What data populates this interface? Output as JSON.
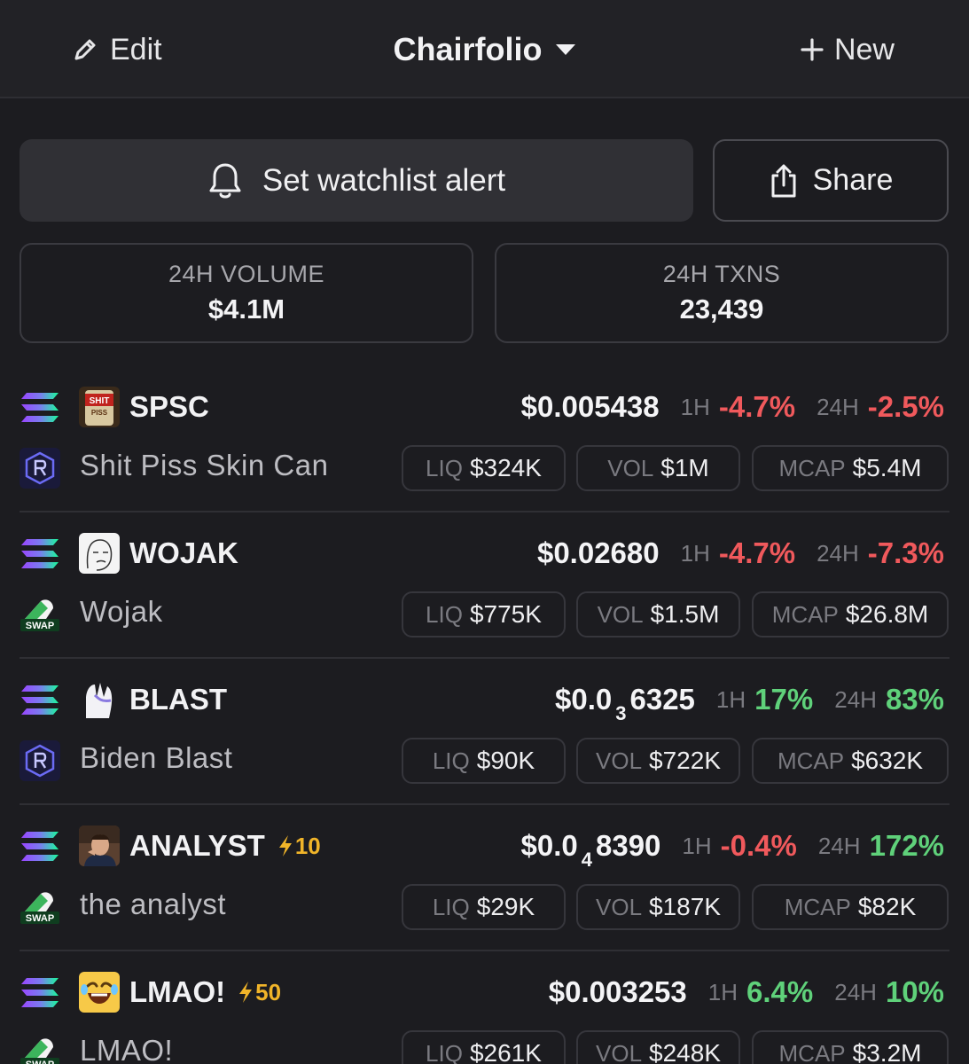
{
  "header": {
    "edit_label": "Edit",
    "title": "Chairfolio",
    "new_label": "New"
  },
  "actions": {
    "alert_label": "Set watchlist alert",
    "share_label": "Share"
  },
  "stats": {
    "volume_label": "24H VOLUME",
    "volume_value": "$4.1M",
    "txns_label": "24H TXNS",
    "txns_value": "23,439"
  },
  "labels": {
    "h1": "1H",
    "h24": "24H",
    "liq": "LIQ",
    "vol": "VOL",
    "mcap": "MCAP"
  },
  "tokens": [
    {
      "symbol": "SPSC",
      "name": "Shit Piss Skin Can",
      "price_pre": "$0.005438",
      "price_sub": "",
      "price_post": "",
      "h1": "-4.7%",
      "h24": "-2.5%",
      "liq": "$324K",
      "vol": "$1M",
      "mcap": "$5.4M",
      "boost": "",
      "dex": "raydium",
      "avatar_text": "SHIT PISS"
    },
    {
      "symbol": "WOJAK",
      "name": "Wojak",
      "price_pre": "$0.02680",
      "price_sub": "",
      "price_post": "",
      "h1": "-4.7%",
      "h24": "-7.3%",
      "liq": "$775K",
      "vol": "$1.5M",
      "mcap": "$26.8M",
      "boost": "",
      "dex": "swap"
    },
    {
      "symbol": "BLAST",
      "name": "Biden Blast",
      "price_pre": "$0.0",
      "price_sub": "3",
      "price_post": "6325",
      "h1": "17%",
      "h24": "83%",
      "liq": "$90K",
      "vol": "$722K",
      "mcap": "$632K",
      "boost": "",
      "dex": "raydium"
    },
    {
      "symbol": "ANALYST",
      "name": "the analyst",
      "price_pre": "$0.0",
      "price_sub": "4",
      "price_post": "8390",
      "h1": "-0.4%",
      "h24": "172%",
      "liq": "$29K",
      "vol": "$187K",
      "mcap": "$82K",
      "boost": "10",
      "dex": "swap"
    },
    {
      "symbol": "LMAO!",
      "name": "LMAO!",
      "price_pre": "$0.003253",
      "price_sub": "",
      "price_post": "",
      "h1": "6.4%",
      "h24": "10%",
      "liq": "$261K",
      "vol": "$248K",
      "mcap": "$3.2M",
      "boost": "50",
      "dex": "swap"
    }
  ],
  "colors": {
    "negative": "#f0595c",
    "positive": "#5fd17a",
    "boost": "#f0b429"
  },
  "icons": [
    "pencil-icon",
    "caret-down-icon",
    "plus-icon",
    "bell-icon",
    "share-icon",
    "solana-icon",
    "raydium-icon",
    "swap-icon",
    "lightning-icon"
  ],
  "dex_badge_text": "SWAP"
}
